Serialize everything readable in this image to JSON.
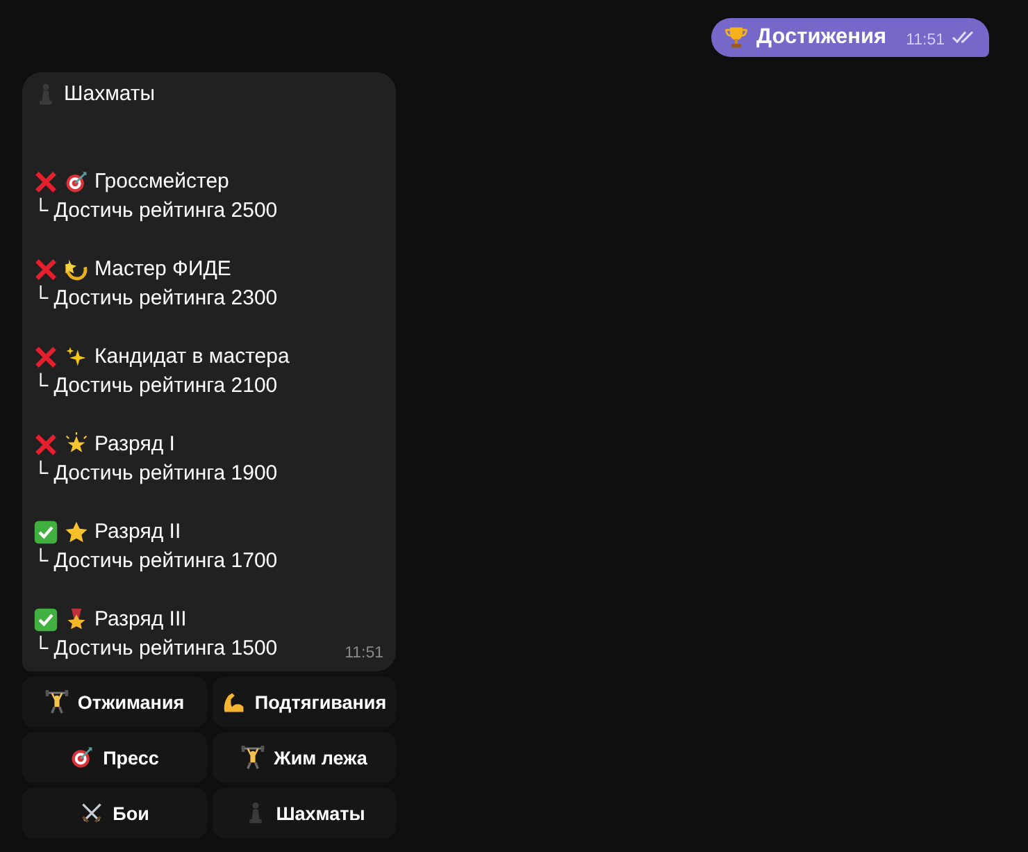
{
  "outgoing": {
    "kind": "trophy",
    "text": "Достижения",
    "time": "11:51",
    "read": true
  },
  "message": {
    "kind": "pawn",
    "title": "Шахматы",
    "time": "11:51",
    "achievements": [
      {
        "done": false,
        "kind": "target",
        "name": "Гроссмейстер",
        "requirement": "└ Достичь рейтинга 2500"
      },
      {
        "done": false,
        "kind": "dizzy",
        "name": "Мастер ФИДЕ",
        "requirement": "└ Достичь рейтинга 2300"
      },
      {
        "done": false,
        "kind": "sparkles",
        "name": "Кандидат в мастера",
        "requirement": "└ Достичь рейтинга 2100"
      },
      {
        "done": false,
        "kind": "glowing-star",
        "name": "Разряд I",
        "requirement": "└ Достичь рейтинга 1900"
      },
      {
        "done": true,
        "kind": "star",
        "name": "Разряд II",
        "requirement": "└ Достичь рейтинга 1700"
      },
      {
        "done": true,
        "kind": "medal",
        "name": "Разряд III",
        "requirement": "└ Достичь рейтинга 1500"
      }
    ]
  },
  "keyboard": [
    [
      {
        "kind": "weightlifter",
        "label": "Отжимания"
      },
      {
        "kind": "muscle",
        "label": "Подтягивания"
      }
    ],
    [
      {
        "kind": "target",
        "label": "Пресс"
      },
      {
        "kind": "weightlifter",
        "label": "Жим лежа"
      }
    ],
    [
      {
        "kind": "swords",
        "label": "Бои"
      },
      {
        "kind": "pawn",
        "label": "Шахматы"
      }
    ]
  ]
}
